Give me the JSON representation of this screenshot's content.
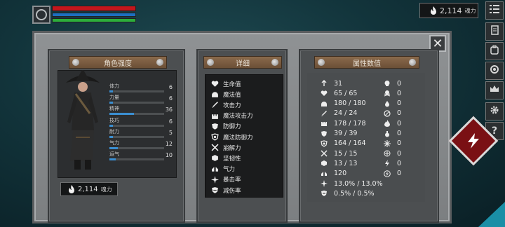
{
  "hud": {
    "emblem_icon": "emblem-icon",
    "bars": [
      "hp",
      "mp",
      "stamina"
    ]
  },
  "top_soul": {
    "value": "2,114",
    "unit": "魂力",
    "icon": "flame-icon"
  },
  "side_buttons": [
    "menu-icon",
    "scroll-icon",
    "backpack-icon",
    "ring-icon",
    "crown-icon",
    "gear-icon",
    "question-icon"
  ],
  "side_labels": {
    "help": "?"
  },
  "close": {
    "label": "✕"
  },
  "character": {
    "title": "角色强度",
    "stats": [
      {
        "label": "体力",
        "value": "6",
        "fill": 0.07
      },
      {
        "label": "力量",
        "value": "6",
        "fill": 0.07
      },
      {
        "label": "精神",
        "value": "36",
        "fill": 0.45
      },
      {
        "label": "技巧",
        "value": "6",
        "fill": 0.07
      },
      {
        "label": "耐力",
        "value": "5",
        "fill": 0.06
      },
      {
        "label": "气力",
        "value": "12",
        "fill": 0.15
      },
      {
        "label": "运气",
        "value": "10",
        "fill": 0.12
      }
    ],
    "soul": {
      "value": "2,114",
      "unit": "魂力"
    }
  },
  "detail": {
    "title": "详细",
    "items": [
      {
        "icon": "heart-icon",
        "label": "生命值"
      },
      {
        "icon": "helmet-icon",
        "label": "魔法值"
      },
      {
        "icon": "sword-icon",
        "label": "攻击力"
      },
      {
        "icon": "castle-icon",
        "label": "魔法攻击力"
      },
      {
        "icon": "shield-icon",
        "label": "防御力"
      },
      {
        "icon": "magic-shield-icon",
        "label": "魔法防御力"
      },
      {
        "icon": "cross-swords-icon",
        "label": "崩解力"
      },
      {
        "icon": "tenacity-icon",
        "label": "坚韧性"
      },
      {
        "icon": "lungs-icon",
        "label": "气力"
      },
      {
        "icon": "star-burst-icon",
        "label": "暴击率"
      },
      {
        "icon": "reduce-shield-icon",
        "label": "减伤率"
      }
    ]
  },
  "values": {
    "title": "属性数值",
    "left": [
      {
        "icon": "level-icon",
        "value": "31"
      },
      {
        "icon": "heart-icon",
        "value": "65 / 65"
      },
      {
        "icon": "helmet-icon",
        "value": "180 / 180"
      },
      {
        "icon": "sword-icon",
        "value": "24 / 24"
      },
      {
        "icon": "castle-icon",
        "value": "178 / 178"
      },
      {
        "icon": "shield-icon",
        "value": "39 / 39"
      },
      {
        "icon": "magic-shield-icon",
        "value": "164 / 164"
      },
      {
        "icon": "cross-swords-icon",
        "value": "15 / 15"
      },
      {
        "icon": "tenacity-icon",
        "value": "13 / 13"
      },
      {
        "icon": "lungs-icon",
        "value": "120"
      },
      {
        "icon": "star-burst-icon",
        "value": "13.0% / 13.0%"
      },
      {
        "icon": "reduce-shield-icon",
        "value": "0.5% / 0.5%"
      }
    ],
    "right": [
      {
        "icon": "skull-icon",
        "value": "0"
      },
      {
        "icon": "skull-crossbones-icon",
        "value": "0"
      },
      {
        "icon": "drop-icon",
        "value": "0"
      },
      {
        "icon": "slash-circle-icon",
        "value": "0"
      },
      {
        "icon": "fire-icon",
        "value": "0"
      },
      {
        "icon": "potion-icon",
        "value": "0"
      },
      {
        "icon": "snowflake-icon",
        "value": "0"
      },
      {
        "icon": "frost-icon",
        "value": "0"
      },
      {
        "icon": "lightning-icon",
        "value": "0"
      },
      {
        "icon": "lightning-circle-icon",
        "value": "0"
      }
    ]
  },
  "colors": {
    "hp": "#c4161c",
    "mp": "#1d6fc0",
    "stamina": "#2cae3b",
    "stat_fill": "#3b8fd2",
    "title_bar": "#7a5a3e"
  }
}
